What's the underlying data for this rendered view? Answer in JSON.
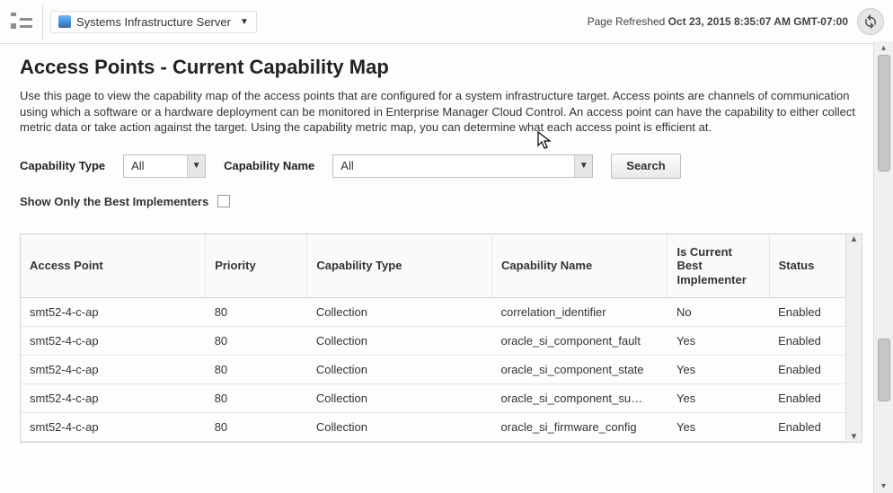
{
  "header": {
    "target_label": "Systems Infrastructure Server",
    "refresh_prefix": "Page Refreshed",
    "refresh_time": "Oct 23, 2015 8:35:07 AM GMT-07:00"
  },
  "page": {
    "title": "Access Points - Current Capability Map",
    "intro": "Use this page to view the capability map of the access points that are configured for a system infrastructure target. Access points are channels of communication using which a software or a hardware deployment can be monitored in Enterprise Manager Cloud Control. An access point can have the capability to either collect metric data or take action against the target. Using the capability metric map, you can determine what each access point is efficient at."
  },
  "filters": {
    "cap_type_label": "Capability Type",
    "cap_type_value": "All",
    "cap_name_label": "Capability Name",
    "cap_name_value": "All",
    "search_label": "Search",
    "best_only_label": "Show Only the Best Implementers"
  },
  "table": {
    "columns": {
      "access_point": "Access Point",
      "priority": "Priority",
      "cap_type": "Capability Type",
      "cap_name": "Capability Name",
      "is_best": "Is Current Best Implementer",
      "status": "Status"
    },
    "rows": [
      {
        "ap": "smt52-4-c-ap",
        "pri": "80",
        "ctype": "Collection",
        "cname": "correlation_identifier",
        "best": "No",
        "status": "Enabled"
      },
      {
        "ap": "smt52-4-c-ap",
        "pri": "80",
        "ctype": "Collection",
        "cname": "oracle_si_component_fault",
        "best": "Yes",
        "status": "Enabled"
      },
      {
        "ap": "smt52-4-c-ap",
        "pri": "80",
        "ctype": "Collection",
        "cname": "oracle_si_component_state",
        "best": "Yes",
        "status": "Enabled"
      },
      {
        "ap": "smt52-4-c-ap",
        "pri": "80",
        "ctype": "Collection",
        "cname": "oracle_si_component_su…",
        "best": "Yes",
        "status": "Enabled"
      },
      {
        "ap": "smt52-4-c-ap",
        "pri": "80",
        "ctype": "Collection",
        "cname": "oracle_si_firmware_config",
        "best": "Yes",
        "status": "Enabled"
      }
    ]
  }
}
